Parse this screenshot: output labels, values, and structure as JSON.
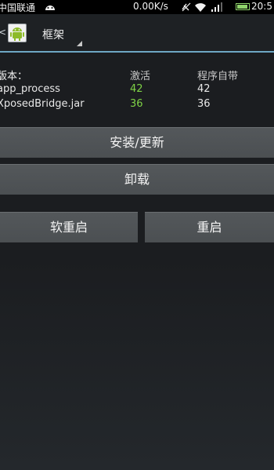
{
  "status_bar": {
    "carrier": "中国联通",
    "speed": "0.00K/s",
    "time": "20:5"
  },
  "action_bar": {
    "back": "<",
    "title": "框架"
  },
  "versions": {
    "title": "版本：",
    "columns": [
      "激活",
      "程序自带"
    ],
    "rows": [
      {
        "name": "app_process",
        "active": "42",
        "bundled": "42"
      },
      {
        "name": "XposedBridge.jar",
        "active": "36",
        "bundled": "36"
      }
    ]
  },
  "buttons": {
    "install": "安装/更新",
    "uninstall": "卸载",
    "soft_reboot": "软重启",
    "reboot": "重启"
  },
  "colors": {
    "active_version": "#7fd346",
    "accent_line": "#6ea7c4",
    "button": "#505457"
  },
  "icons": [
    "android-status-icon",
    "android-app-icon",
    "wifi-icon",
    "signal-icon",
    "battery-icon"
  ]
}
